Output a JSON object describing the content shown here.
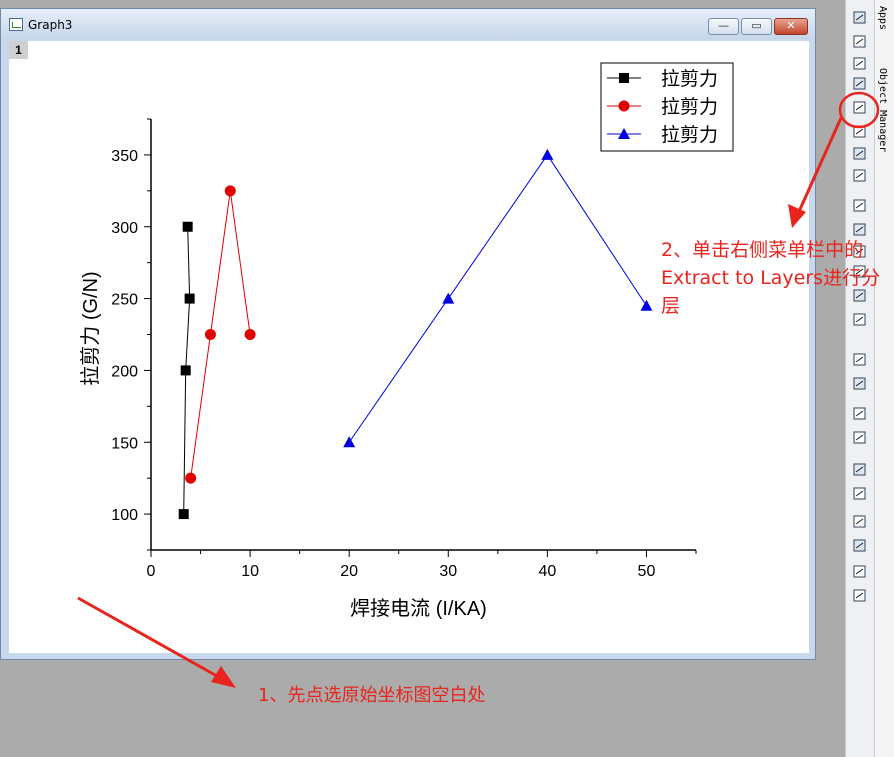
{
  "window": {
    "title": "Graph3",
    "min_label": "—",
    "max_label": "▭",
    "close_label": "✕",
    "layer_label": "1"
  },
  "chart_data": {
    "type": "line",
    "xlabel": "焊接电流 (I/KA)",
    "ylabel": "拉剪力 (G/N)",
    "xlim": [
      0,
      55
    ],
    "ylim": [
      75,
      375
    ],
    "xticks": [
      0,
      10,
      20,
      30,
      40,
      50
    ],
    "yticks": [
      100,
      150,
      200,
      250,
      300,
      350
    ],
    "legend_position": "top-right",
    "series": [
      {
        "name": "拉剪力",
        "color": "#000000",
        "marker": "square",
        "x": [
          3.3,
          3.5,
          3.9,
          3.7
        ],
        "y": [
          100,
          200,
          250,
          300
        ]
      },
      {
        "name": "拉剪力",
        "color": "#e00000",
        "marker": "circle",
        "x": [
          4,
          6,
          8,
          10
        ],
        "y": [
          125,
          225,
          325,
          225
        ]
      },
      {
        "name": "拉剪力",
        "color": "#0000e0",
        "marker": "triangle",
        "x": [
          20,
          30,
          40,
          50
        ],
        "y": [
          150,
          250,
          350,
          245
        ]
      }
    ]
  },
  "toolbar": {
    "icons": [
      "text-tool-icon",
      "scale-icon",
      "rotate-icon",
      "rescale-icon",
      "extract-to-layers-icon",
      "merge-graphs-icon",
      "arrange-layers-icon",
      "layer-contents-icon",
      "add-axis-bottom-icon",
      "add-axis-top-icon",
      "add-axis-left-icon",
      "add-axis-right-icon",
      "align-left-icon",
      "align-right-icon",
      "align-top-icon",
      "align-bottom-icon",
      "align-center-h-icon",
      "align-center-v-icon",
      "same-width-icon",
      "same-height-icon",
      "front-icon",
      "back-icon",
      "group-icon",
      "ungroup-icon"
    ]
  },
  "side_tabs": {
    "apps": "Apps",
    "object_manager": "Object Manager"
  },
  "annotations": {
    "step1": "1、先点选原始坐标图空白处",
    "step2_line1": "2、单击右侧菜单栏中的",
    "step2_line2": "Extract to Layers进行分",
    "step2_line3": "层",
    "color": "#e8241c"
  }
}
